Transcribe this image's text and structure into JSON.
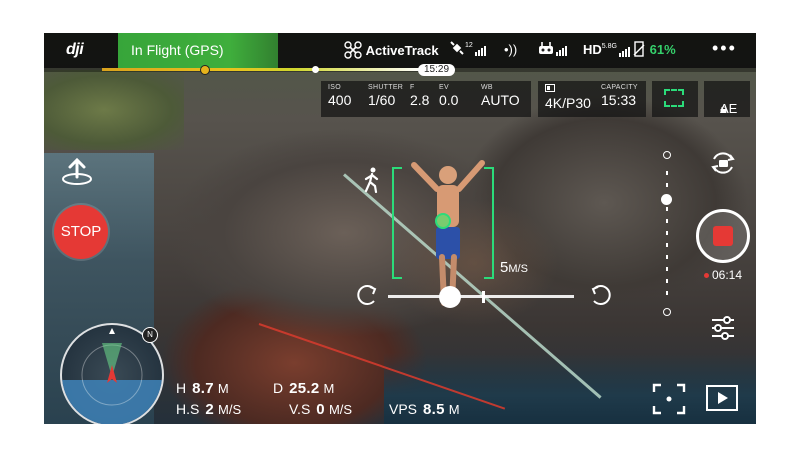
{
  "app": {
    "logo": "dji",
    "flight_status": "In Flight (GPS)"
  },
  "topbar": {
    "mode_label": "ActiveTrack",
    "gps_count": "12",
    "hd_band": "5.8G",
    "hd_label": "HD",
    "battery_percent": "61%"
  },
  "timeline": {
    "time_label": "15:29"
  },
  "camera_settings": {
    "iso_label": "ISO",
    "iso_value": "400",
    "shutter_label": "SHUTTER",
    "shutter_value": "1/60",
    "f_label": "F",
    "f_value": "2.8",
    "ev_label": "EV",
    "ev_value": "0.0",
    "wb_label": "WB",
    "wb_value": "AUTO",
    "resolution_value": "4K/P30",
    "capacity_label": "CAPACITY",
    "capacity_value": "15:33",
    "ae_label": "AE"
  },
  "left_controls": {
    "stop_label": "STOP"
  },
  "tracking": {
    "speed_value": "5",
    "speed_unit": "M/S"
  },
  "recording": {
    "time": "06:14"
  },
  "radar": {
    "north_label": "N"
  },
  "telemetry": {
    "h_label": "H",
    "h_value": "8.7",
    "h_unit": "M",
    "d_label": "D",
    "d_value": "25.2",
    "d_unit": "M",
    "hs_label": "H.S",
    "hs_value": "2",
    "hs_unit": "M/S",
    "vs_label": "V.S",
    "vs_value": "0",
    "vs_unit": "M/S",
    "vps_label": "VPS",
    "vps_value": "8.5",
    "vps_unit": "M"
  },
  "colors": {
    "accent_green": "#2bdc7a",
    "status_green": "#3fae3c",
    "stop_red": "#e53935",
    "battery_green": "#35d06b"
  }
}
